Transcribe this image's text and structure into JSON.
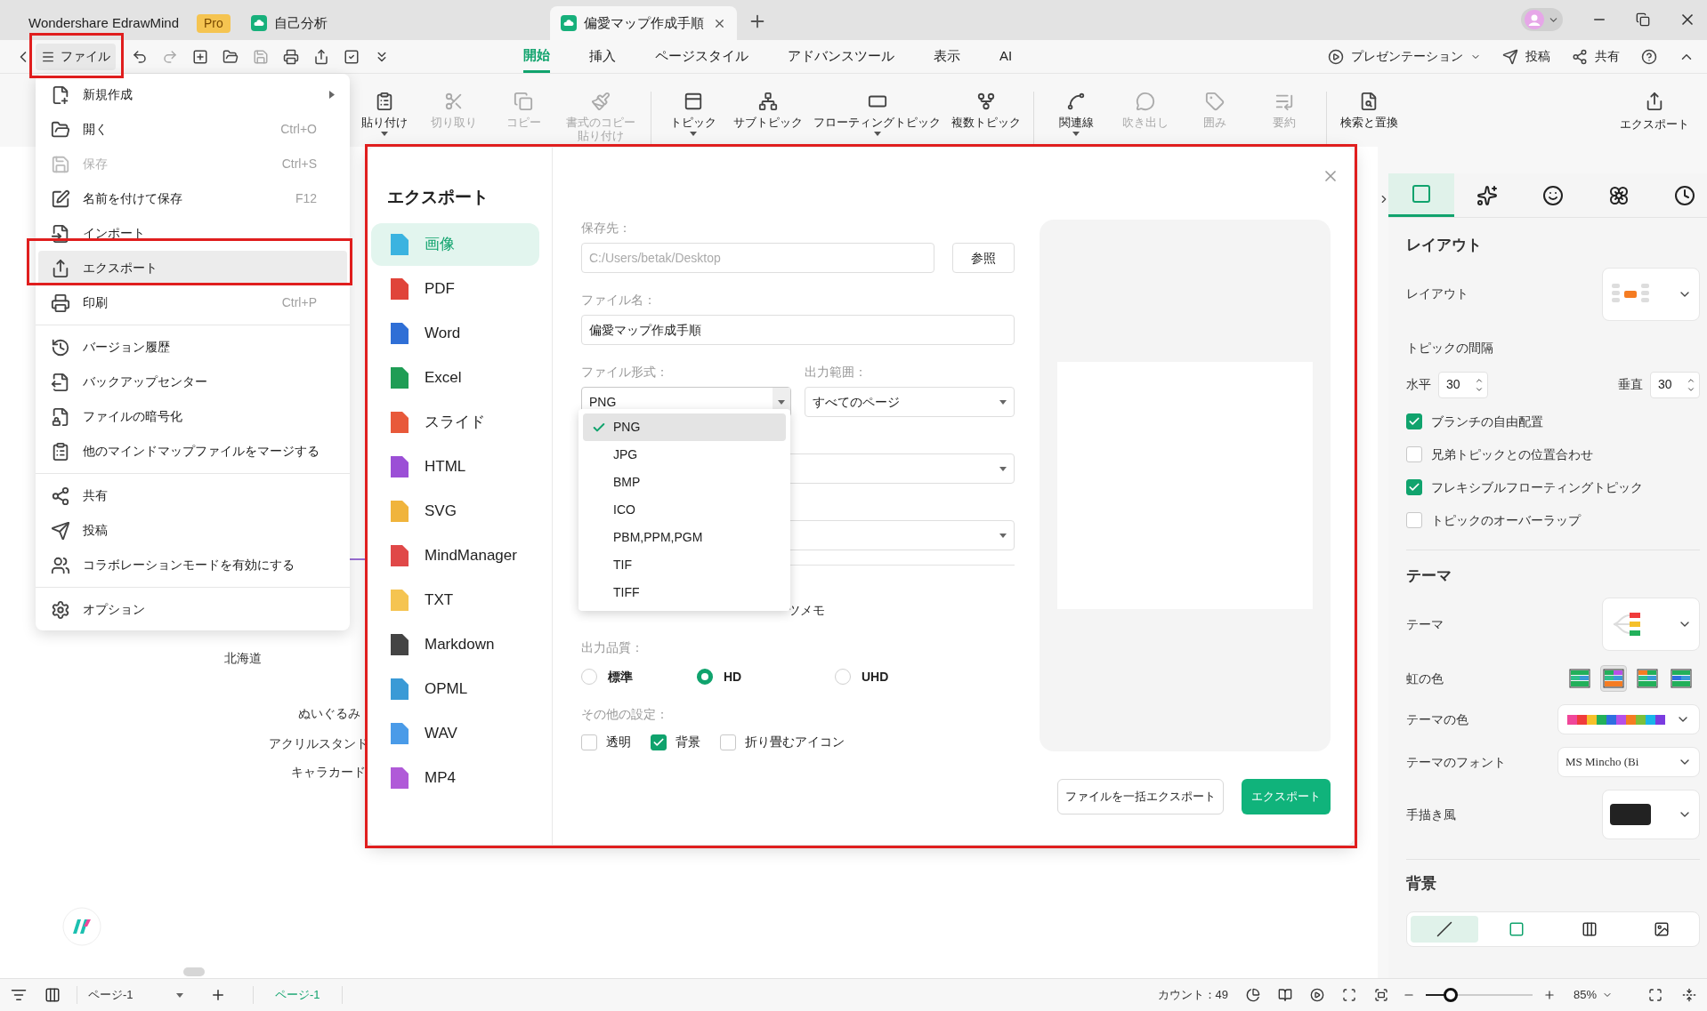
{
  "tabs": [
    {
      "label": "Wondershare EdrawMind",
      "badge": "Pro",
      "kind": "app",
      "selected": false
    },
    {
      "label": "自己分析",
      "kind": "doc",
      "selected": false
    },
    {
      "label": "偏愛マップ作成手順",
      "kind": "doc",
      "selected": true
    }
  ],
  "toolbar": {
    "file_label": "ファイル",
    "menu_tabs": [
      {
        "label": "開始",
        "selected": true
      },
      {
        "label": "挿入",
        "selected": false
      },
      {
        "label": "ページスタイル",
        "selected": false
      },
      {
        "label": "アドバンスツール",
        "selected": false
      },
      {
        "label": "表示",
        "selected": false
      },
      {
        "label": "AI",
        "selected": false
      }
    ],
    "actions": [
      {
        "label": "プレゼンテーション",
        "dropdown": true
      },
      {
        "label": "投稿",
        "dropdown": false
      },
      {
        "label": "共有",
        "dropdown": false
      }
    ]
  },
  "ribbon": {
    "groups": [
      [
        {
          "label": "貼り付け",
          "disabled": false,
          "dropdown": true
        },
        {
          "label": "切り取り",
          "disabled": true,
          "dropdown": false
        },
        {
          "label": "コピー",
          "disabled": true,
          "dropdown": false
        },
        {
          "label": "書式のコピー貼り付け",
          "disabled": true,
          "dropdown": false
        }
      ],
      [
        {
          "label": "トピック",
          "disabled": false,
          "dropdown": true
        },
        {
          "label": "サブトピック",
          "disabled": false,
          "dropdown": false
        },
        {
          "label": "フローティングトピック",
          "disabled": false,
          "dropdown": true
        },
        {
          "label": "複数トピック",
          "disabled": false,
          "dropdown": false
        }
      ],
      [
        {
          "label": "関連線",
          "disabled": false,
          "dropdown": true
        },
        {
          "label": "吹き出し",
          "disabled": true,
          "dropdown": false
        },
        {
          "label": "囲み",
          "disabled": true,
          "dropdown": false
        },
        {
          "label": "要約",
          "disabled": true,
          "dropdown": false
        }
      ],
      [
        {
          "label": "検索と置換",
          "disabled": false,
          "dropdown": false
        }
      ]
    ],
    "export_label": "エクスポート"
  },
  "file_menu": {
    "sections": [
      [
        {
          "label": "新規作成",
          "disabled": false,
          "highlighted": false,
          "submenu": true
        },
        {
          "label": "開く",
          "shortcut": "Ctrl+O",
          "disabled": false,
          "highlighted": false,
          "submenu": false
        },
        {
          "label": "保存",
          "shortcut": "Ctrl+S",
          "disabled": true,
          "highlighted": false,
          "submenu": false
        },
        {
          "label": "名前を付けて保存",
          "shortcut": "F12",
          "disabled": false,
          "highlighted": false,
          "submenu": false
        },
        {
          "label": "インポート",
          "disabled": false,
          "highlighted": false,
          "submenu": false
        },
        {
          "label": "エクスポート",
          "disabled": false,
          "highlighted": true,
          "submenu": false
        },
        {
          "label": "印刷",
          "shortcut": "Ctrl+P",
          "disabled": false,
          "highlighted": false,
          "submenu": false
        }
      ],
      [
        {
          "label": "バージョン履歴",
          "disabled": false,
          "highlighted": false,
          "submenu": false
        },
        {
          "label": "バックアップセンター",
          "disabled": false,
          "highlighted": false,
          "submenu": false
        },
        {
          "label": "ファイルの暗号化",
          "disabled": false,
          "highlighted": false,
          "submenu": false
        },
        {
          "label": "他のマインドマップファイルをマージする",
          "disabled": false,
          "highlighted": false,
          "submenu": false
        }
      ],
      [
        {
          "label": "共有",
          "disabled": false,
          "highlighted": false,
          "submenu": false
        },
        {
          "label": "投稿",
          "disabled": false,
          "highlighted": false,
          "submenu": false
        },
        {
          "label": "コラボレーションモードを有効にする",
          "disabled": false,
          "highlighted": false,
          "submenu": false
        }
      ],
      [
        {
          "label": "オプション",
          "disabled": false,
          "highlighted": false,
          "submenu": false
        }
      ]
    ]
  },
  "canvas": {
    "labels": [
      "北海道",
      "ぬいぐるみ",
      "アクリルスタンド",
      "キャラカード"
    ]
  },
  "export_dialog": {
    "title": "エクスポート",
    "formats": [
      {
        "label": "画像",
        "color": "#3bb3e0",
        "selected": true
      },
      {
        "label": "PDF",
        "color": "#e0443a",
        "selected": false
      },
      {
        "label": "Word",
        "color": "#2f6fd6",
        "selected": false
      },
      {
        "label": "Excel",
        "color": "#1f9d55",
        "selected": false
      },
      {
        "label": "スライド",
        "color": "#e8593a",
        "selected": false
      },
      {
        "label": "HTML",
        "color": "#9b4fd6",
        "selected": false
      },
      {
        "label": "SVG",
        "color": "#f0b43c",
        "selected": false
      },
      {
        "label": "MindManager",
        "color": "#e04848",
        "selected": false
      },
      {
        "label": "TXT",
        "color": "#f5c451",
        "selected": false
      },
      {
        "label": "Markdown",
        "color": "#444444",
        "selected": false
      },
      {
        "label": "OPML",
        "color": "#3a9ad6",
        "selected": false
      },
      {
        "label": "WAV",
        "color": "#4a9be8",
        "selected": false
      },
      {
        "label": "MP4",
        "color": "#b05ad8",
        "selected": false
      }
    ],
    "save_to": {
      "label": "保存先：",
      "placeholder": "C:/Users/betak/Desktop",
      "browse": "参照"
    },
    "file_name": {
      "label": "ファイル名：",
      "value": "偏愛マップ作成手順"
    },
    "file_format": {
      "label": "ファイル形式：",
      "value": "PNG",
      "options": [
        {
          "label": "PNG",
          "selected": true
        },
        {
          "label": "JPG",
          "selected": false
        },
        {
          "label": "BMP",
          "selected": false
        },
        {
          "label": "ICO",
          "selected": false
        },
        {
          "label": "PBM,PPM,PGM",
          "selected": false
        },
        {
          "label": "TIF",
          "selected": false
        },
        {
          "label": "TIFF",
          "selected": false
        }
      ]
    },
    "range": {
      "label": "出力範囲：",
      "value": "すべてのページ"
    },
    "covered_fragment": "ツメモ",
    "quality": {
      "label": "出力品質：",
      "options": [
        {
          "label": "標準",
          "selected": false
        },
        {
          "label": "HD",
          "selected": true
        },
        {
          "label": "UHD",
          "selected": false
        }
      ]
    },
    "other": {
      "label": "その他の設定：",
      "options": [
        {
          "label": "透明",
          "checked": false
        },
        {
          "label": "背景",
          "checked": true
        },
        {
          "label": "折り畳むアイコン",
          "checked": false
        }
      ]
    },
    "buttons": [
      {
        "label": "ファイルを一括エクスポート",
        "kind": "secondary"
      },
      {
        "label": "エクスポート",
        "kind": "primary"
      }
    ]
  },
  "side_panel": {
    "tabs": [
      {
        "selected": true
      },
      {
        "selected": false
      },
      {
        "selected": false
      },
      {
        "selected": false
      },
      {
        "selected": false
      }
    ],
    "layout": {
      "title": "レイアウト",
      "layout_label": "レイアウト",
      "spacing_label": "トピックの間隔",
      "horizontal": {
        "label": "水平",
        "value": "30"
      },
      "vertical": {
        "label": "垂直",
        "value": "30"
      },
      "options": [
        {
          "label": "ブランチの自由配置",
          "checked": true
        },
        {
          "label": "兄弟トピックとの位置合わせ",
          "checked": false
        },
        {
          "label": "フレキシブルフローティングトピック",
          "checked": true
        },
        {
          "label": "トピックのオーバーラップ",
          "checked": false
        }
      ]
    },
    "theme": {
      "title": "テーマ",
      "theme_label": "テーマ",
      "rainbow_label": "虹の色",
      "rainbow_styles": [
        {
          "selected": false
        },
        {
          "selected": true
        },
        {
          "selected": false
        },
        {
          "selected": false
        }
      ],
      "theme_color_label": "テーマの色",
      "palette": [
        {
          "color": "#f0479a"
        },
        {
          "color": "#f03c3c"
        },
        {
          "color": "#f5c02a"
        },
        {
          "color": "#22b05a"
        },
        {
          "color": "#2f6fe0"
        },
        {
          "color": "#b650e8"
        },
        {
          "color": "#f57c22"
        },
        {
          "color": "#7cbf3a"
        },
        {
          "color": "#19b5e8"
        },
        {
          "color": "#7a3ce0"
        }
      ],
      "font_label": "テーマのフォント",
      "font_value": "MS Mincho (Bi",
      "hand_drawn_label": "手描き風"
    },
    "background": {
      "title": "背景",
      "styles": [
        {
          "selected": true
        },
        {
          "selected": false
        },
        {
          "selected": false
        },
        {
          "selected": false
        }
      ]
    }
  },
  "status_bar": {
    "page_select": "ページ-1",
    "page_tab": "ページ-1",
    "count": "カウント：49",
    "zoom_slider": {
      "level": 0.23
    },
    "zoom": "85%"
  }
}
